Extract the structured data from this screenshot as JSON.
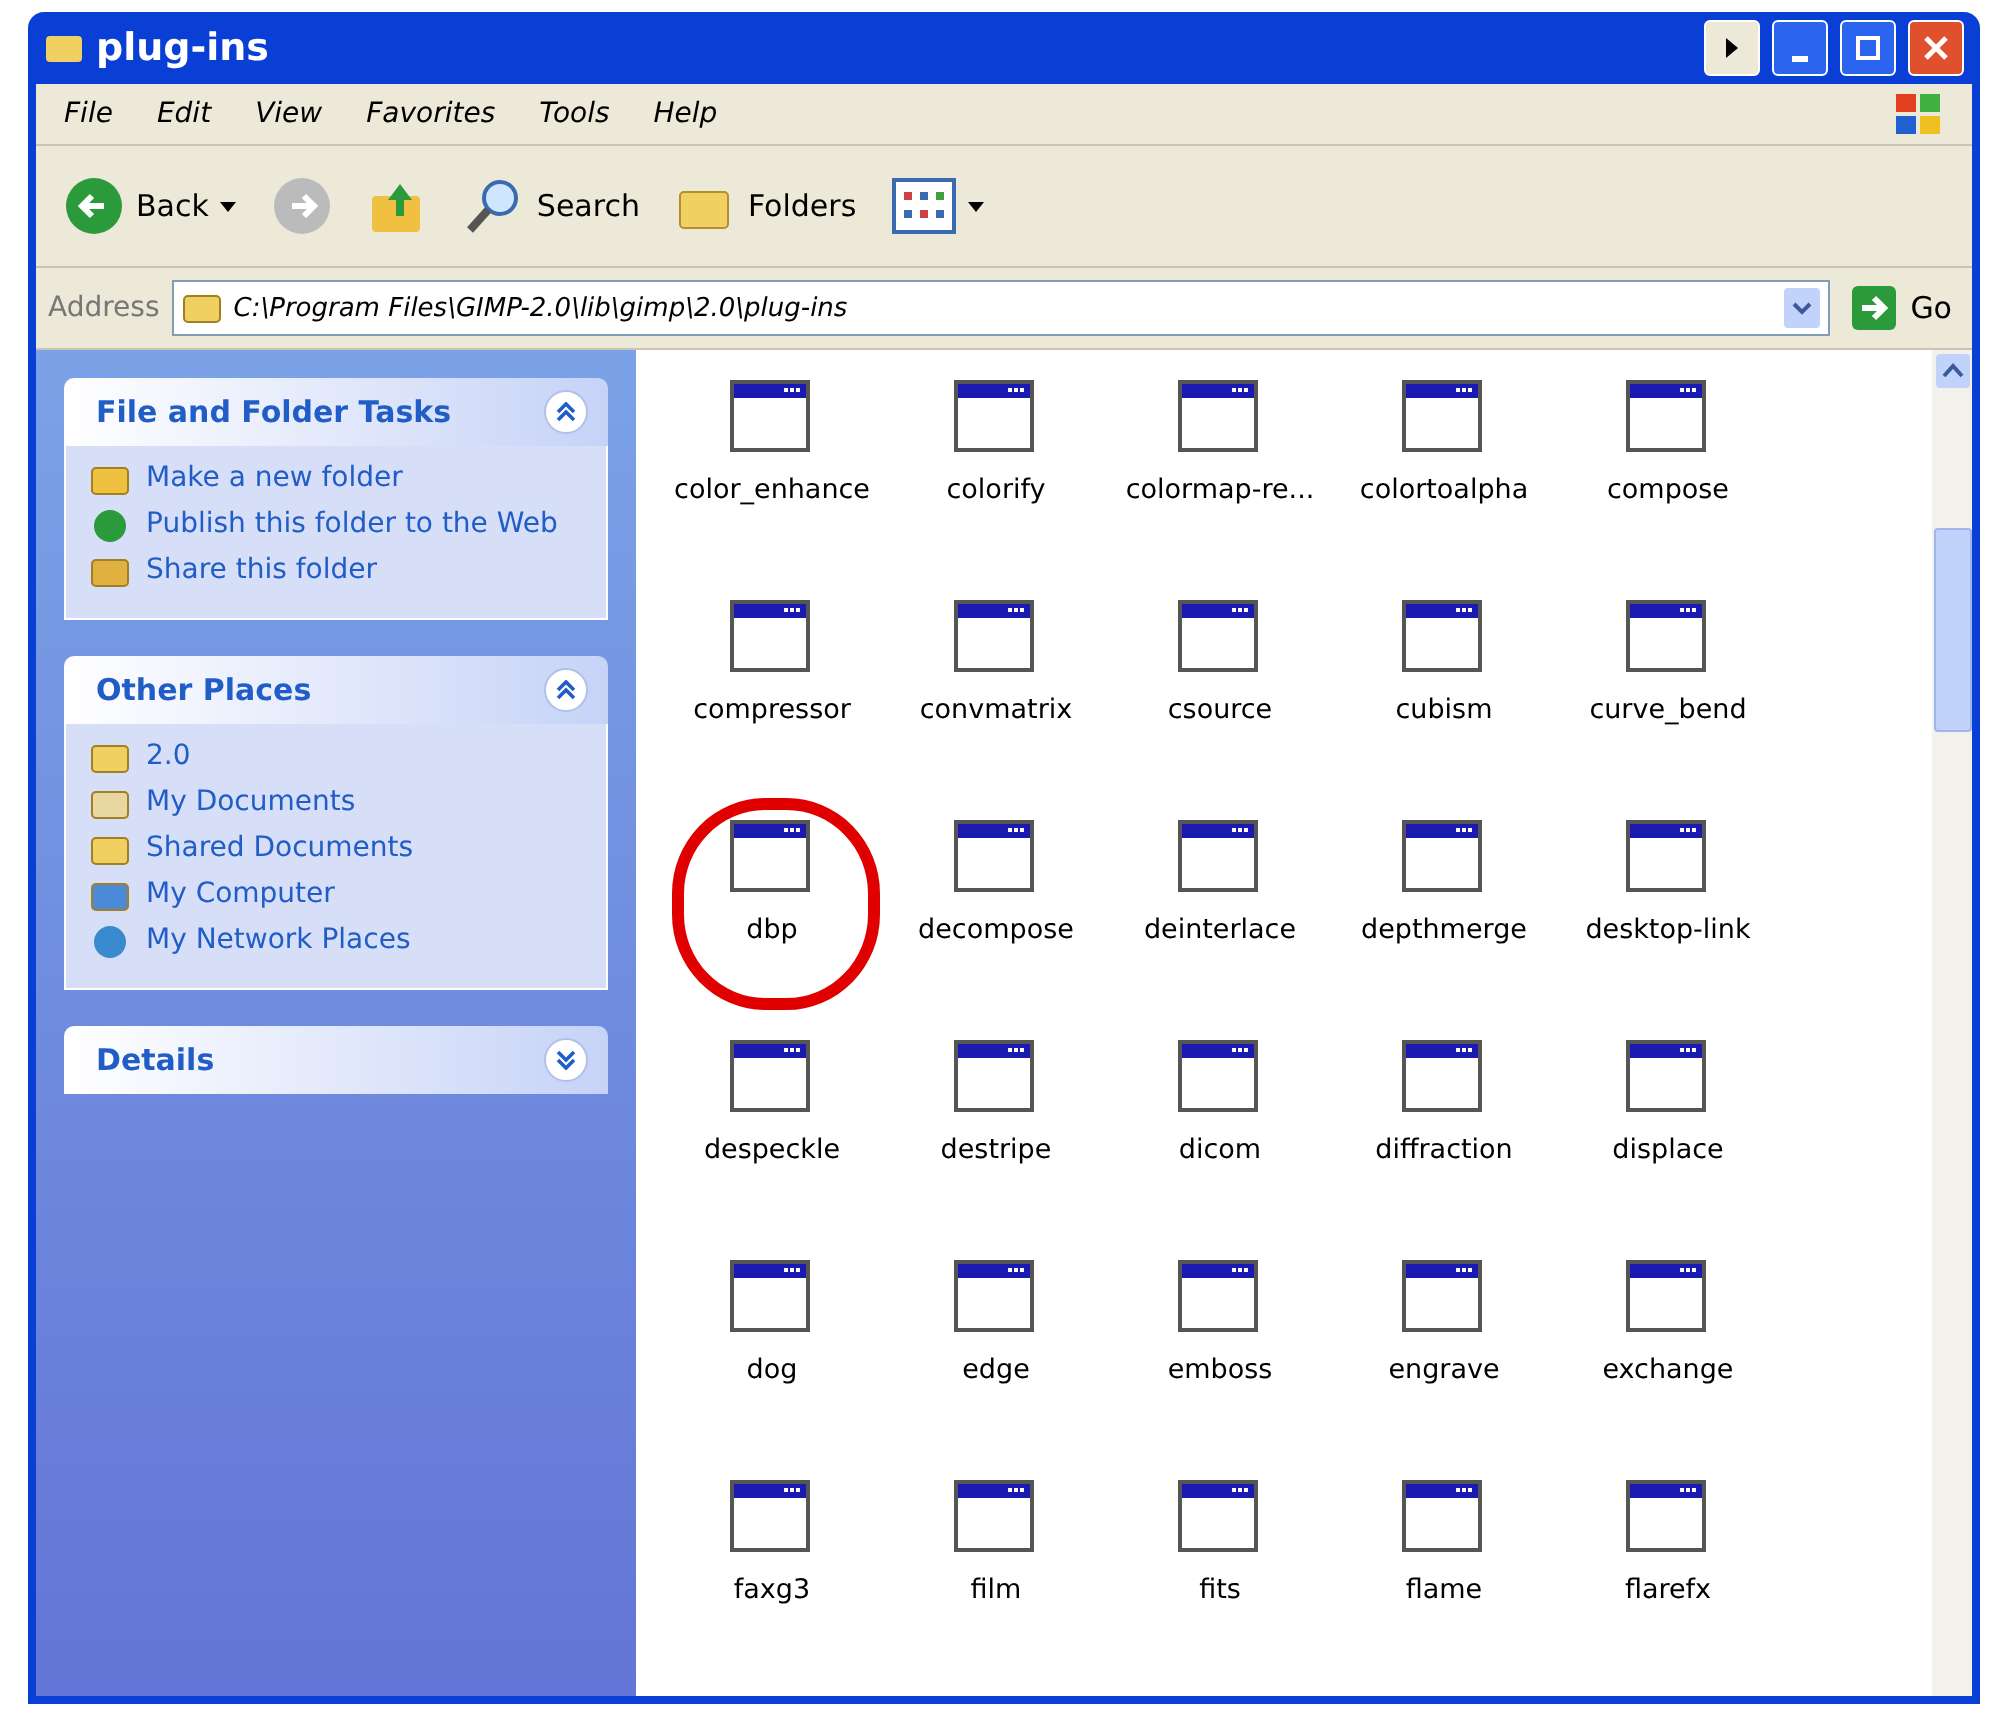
{
  "window": {
    "title": "plug-ins"
  },
  "menu": [
    "File",
    "Edit",
    "View",
    "Favorites",
    "Tools",
    "Help"
  ],
  "toolbar": {
    "back": "Back",
    "search": "Search",
    "folders": "Folders"
  },
  "address": {
    "label": "Address",
    "value": "C:\\Program Files\\GIMP-2.0\\lib\\gimp\\2.0\\plug-ins",
    "go": "Go"
  },
  "panels": [
    {
      "title": "File and Folder Tasks",
      "expanded": true,
      "items": [
        {
          "label": "Make a new folder",
          "kind": "new-folder"
        },
        {
          "label": "Publish this folder to the Web",
          "kind": "publish"
        },
        {
          "label": "Share this folder",
          "kind": "share"
        }
      ]
    },
    {
      "title": "Other Places",
      "expanded": true,
      "items": [
        {
          "label": "2.0",
          "kind": "folder"
        },
        {
          "label": "My Documents",
          "kind": "documents"
        },
        {
          "label": "Shared Documents",
          "kind": "folder"
        },
        {
          "label": "My Computer",
          "kind": "computer"
        },
        {
          "label": "My Network Places",
          "kind": "network"
        }
      ]
    },
    {
      "title": "Details",
      "expanded": false
    }
  ],
  "files": [
    {
      "name": "color_enhance",
      "highlighted": false
    },
    {
      "name": "colorify",
      "highlighted": false
    },
    {
      "name": "colormap-re...",
      "highlighted": false
    },
    {
      "name": "colortoalpha",
      "highlighted": false
    },
    {
      "name": "compose",
      "highlighted": false
    },
    {
      "name": "compressor",
      "highlighted": false
    },
    {
      "name": "convmatrix",
      "highlighted": false
    },
    {
      "name": "csource",
      "highlighted": false
    },
    {
      "name": "cubism",
      "highlighted": false
    },
    {
      "name": "curve_bend",
      "highlighted": false
    },
    {
      "name": "dbp",
      "highlighted": true
    },
    {
      "name": "decompose",
      "highlighted": false
    },
    {
      "name": "deinterlace",
      "highlighted": false
    },
    {
      "name": "depthmerge",
      "highlighted": false
    },
    {
      "name": "desktop-link",
      "highlighted": false
    },
    {
      "name": "despeckle",
      "highlighted": false
    },
    {
      "name": "destripe",
      "highlighted": false
    },
    {
      "name": "dicom",
      "highlighted": false
    },
    {
      "name": "diffraction",
      "highlighted": false
    },
    {
      "name": "displace",
      "highlighted": false
    },
    {
      "name": "dog",
      "highlighted": false
    },
    {
      "name": "edge",
      "highlighted": false
    },
    {
      "name": "emboss",
      "highlighted": false
    },
    {
      "name": "engrave",
      "highlighted": false
    },
    {
      "name": "exchange",
      "highlighted": false
    },
    {
      "name": "faxg3",
      "highlighted": false
    },
    {
      "name": "film",
      "highlighted": false
    },
    {
      "name": "fits",
      "highlighted": false
    },
    {
      "name": "flame",
      "highlighted": false
    },
    {
      "name": "flarefx",
      "highlighted": false
    }
  ]
}
